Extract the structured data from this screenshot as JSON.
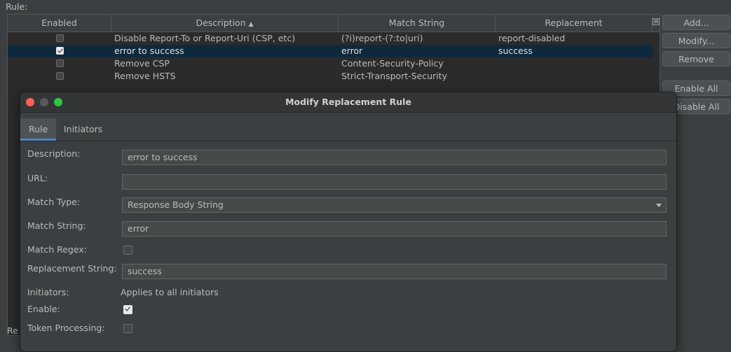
{
  "rule_label": "Rule:",
  "table": {
    "columns": [
      {
        "label": "Enabled"
      },
      {
        "label": "Description",
        "sort": "▲"
      },
      {
        "label": "Match String"
      },
      {
        "label": "Replacement"
      }
    ],
    "rows": [
      {
        "enabled": false,
        "description": "Disable Report-To or Report-Uri (CSP, etc)",
        "match": "(?i)report-(?:to|uri)",
        "replacement": "report-disabled",
        "selected": false
      },
      {
        "enabled": true,
        "description": "error to success",
        "match": "error",
        "replacement": "success",
        "selected": true
      },
      {
        "enabled": false,
        "description": "Remove CSP",
        "match": "Content-Security-Policy",
        "replacement": "",
        "selected": false
      },
      {
        "enabled": false,
        "description": "Remove HSTS",
        "match": "Strict-Transport-Security",
        "replacement": "",
        "selected": false
      }
    ]
  },
  "side_buttons": {
    "add": "Add...",
    "modify": "Modify...",
    "remove": "Remove",
    "enable_all": "Enable All",
    "disable_all": "Disable All"
  },
  "bottom_fragment": "Re",
  "dialog": {
    "title": "Modify Replacement Rule",
    "tabs": [
      "Rule",
      "Initiators"
    ],
    "fields": {
      "description_label": "Description:",
      "description_value": "error to success",
      "url_label": "URL:",
      "url_value": "",
      "match_type_label": "Match Type:",
      "match_type_value": "Response Body String",
      "match_string_label": "Match String:",
      "match_string_value": "error",
      "match_regex_label": "Match Regex:",
      "match_regex_checked": false,
      "replacement_label": "Replacement String:",
      "replacement_value": "success",
      "initiators_label": "Initiators:",
      "initiators_value": "Applies to all initiators",
      "enable_label": "Enable:",
      "enable_checked": true,
      "token_label": "Token Processing:",
      "token_checked": false
    }
  },
  "colors": {
    "background": "#3c3f41",
    "table_background": "#2b2b2b",
    "selected_row": "#0d293e",
    "tab_accent": "#4a88c7"
  }
}
